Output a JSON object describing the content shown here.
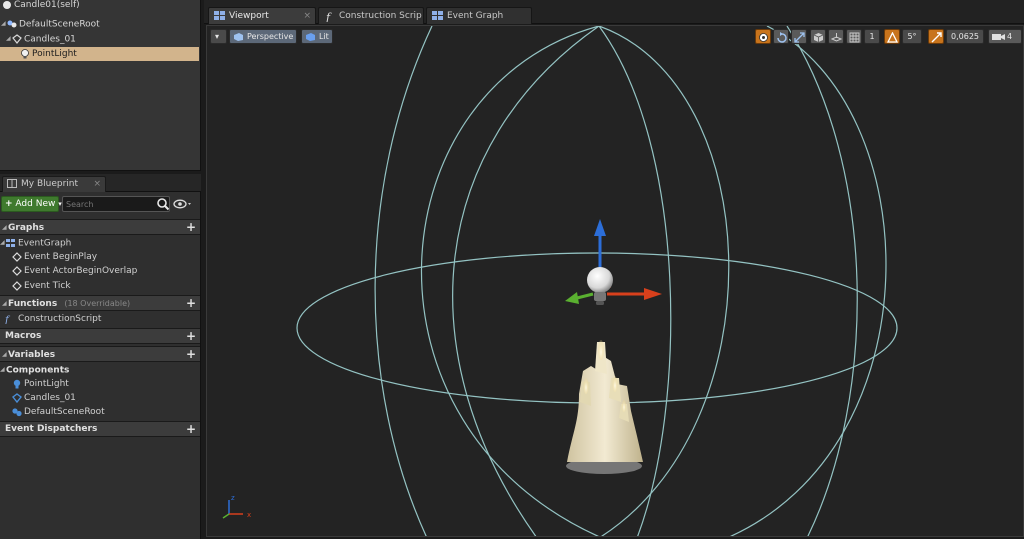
{
  "components": {
    "items": [
      {
        "label": "Candle01(self)"
      },
      {
        "label": "DefaultSceneRoot"
      },
      {
        "label": "Candles_01"
      },
      {
        "label": "PointLight"
      }
    ]
  },
  "my_blueprint": {
    "tab_label": "My Blueprint",
    "add_new_label": "Add New",
    "search_placeholder": "Search",
    "sections": {
      "graphs": "Graphs",
      "functions": "Functions",
      "functions_count": "(18 Overridable)",
      "macros": "Macros",
      "variables": "Variables",
      "components": "Components",
      "event_dispatchers": "Event Dispatchers"
    },
    "graph_items": {
      "event_graph": "EventGraph",
      "begin_play": "Event BeginPlay",
      "begin_overlap": "Event ActorBeginOverlap",
      "tick": "Event Tick"
    },
    "function_items": {
      "construction": "ConstructionScript"
    },
    "component_items": {
      "point_light": "PointLight",
      "candles": "Candles_01",
      "scene_root": "DefaultSceneRoot"
    }
  },
  "editor_tabs": [
    {
      "label": "Viewport"
    },
    {
      "label": "Construction Scrip"
    },
    {
      "label": "Event Graph"
    }
  ],
  "viewport": {
    "perspective_label": "Perspective",
    "lit_label": "Lit",
    "grid_snap_value": "1",
    "rotation_snap_value": "5°",
    "scale_snap_value": "0,0625",
    "camera_speed_value": "4"
  },
  "colors": {
    "selected_row": "#d2b48c",
    "add_new_green": "#3f7a2e",
    "snap_orange": "#c8741c",
    "gizmo_x": "#d8401c",
    "gizmo_y": "#5ab030",
    "gizmo_z": "#2c6ed8",
    "light_radius": "#a8e0e0"
  }
}
